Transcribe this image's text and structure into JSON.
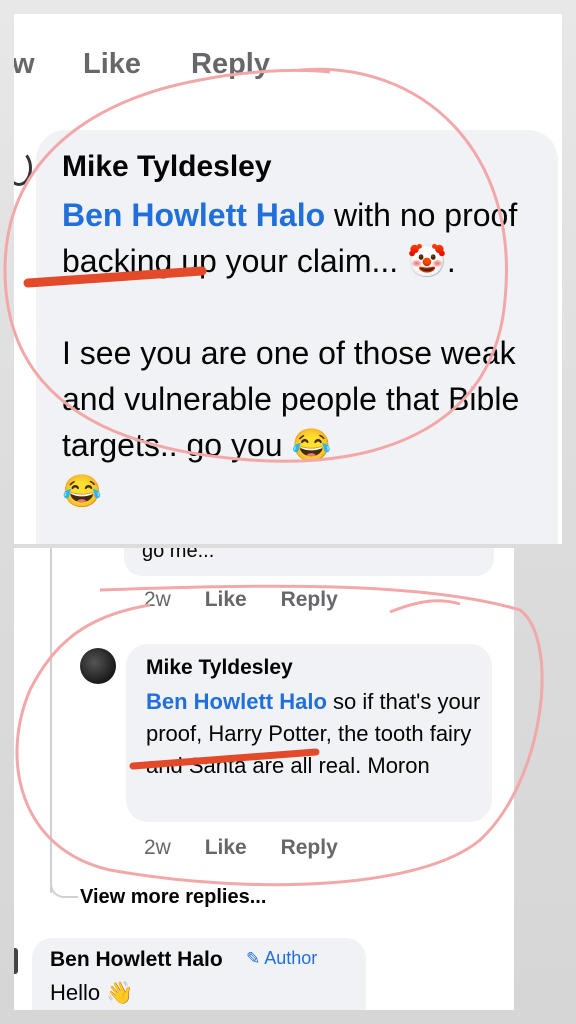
{
  "top": {
    "actions": [
      "w",
      "Like",
      "Reply"
    ],
    "comment": {
      "author": "Mike Tyldesley",
      "mention": "Ben Howlett Halo",
      "line_a": " with no proof backing up your claim... ",
      "emoji_clown": "🤡",
      "period": ".",
      "line_b": "I see you are one of those weak and vulnerable people that Bible targets.. go you ",
      "emoji_laugh": "😂",
      "emoji_laugh2": "😂"
    }
  },
  "bottom": {
    "prev_fragment": "go me...",
    "prev_meta": {
      "time": "2w",
      "like": "Like",
      "reply": "Reply"
    },
    "reply": {
      "author": "Mike Tyldesley",
      "mention": "Ben Howlett Halo",
      "text": " so if that's your proof, Harry Potter, the tooth fairy and Santa are all real. Moron",
      "meta": {
        "time": "2w",
        "like": "Like",
        "reply": "Reply"
      }
    },
    "view_more": "View more replies...",
    "last": {
      "author": "Ben Howlett Halo",
      "badge": "Author",
      "badge_icon": "✎",
      "text": "Hello ",
      "emoji_wave": "👋"
    }
  },
  "colors": {
    "mention": "#216fdb",
    "bubble": "#f0f2f5",
    "meta_gray": "#65676b",
    "annotation_red": "#e34a2a",
    "annotation_pink": "#f2a8a8"
  }
}
